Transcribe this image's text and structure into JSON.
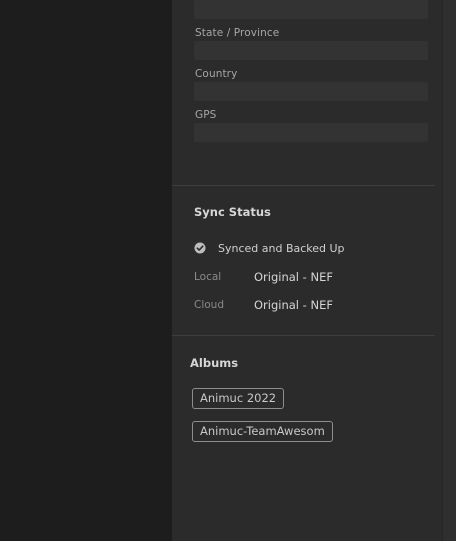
{
  "location_fields": [
    {
      "label": "State / Province",
      "value": ""
    },
    {
      "label": "Country",
      "value": ""
    },
    {
      "label": "GPS",
      "value": ""
    }
  ],
  "sync_status": {
    "title": "Sync Status",
    "status_text": "Synced and Backed Up",
    "status_icon": "check-circle-icon",
    "local_label": "Local",
    "local_value": "Original - NEF",
    "cloud_label": "Cloud",
    "cloud_value": "Original - NEF"
  },
  "albums": {
    "title": "Albums",
    "items": [
      "Animuc 2022",
      "Animuc-TeamAwesom"
    ]
  },
  "colors": {
    "panel_bg": "#2b2b2b",
    "left_bg": "#1d1d1d",
    "field_bg": "#333333",
    "tag_border": "#8e8e8e"
  }
}
